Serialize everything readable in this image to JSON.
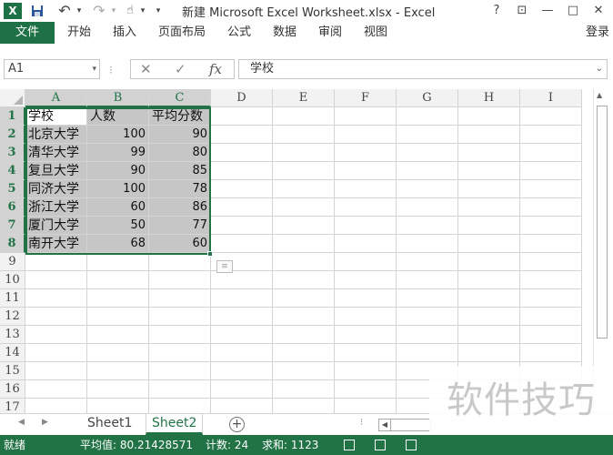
{
  "window": {
    "title": "新建 Microsoft Excel Worksheet.xlsx - Excel",
    "help": "?",
    "restore_ribbon": "⊡",
    "minimize": "—",
    "maximize": "□",
    "close": "✕"
  },
  "quick_access": {
    "logo": "X",
    "save_icon": "💾",
    "undo_icon": "↶",
    "redo_icon": "↷",
    "touch_icon": "☝",
    "customize_icon": "▾"
  },
  "ribbon": {
    "file_tab": "文件",
    "tabs": [
      "开始",
      "插入",
      "页面布局",
      "公式",
      "数据",
      "审阅",
      "视图"
    ],
    "login": "登录"
  },
  "formula_bar": {
    "name_box": "A1",
    "name_box_arrow": "▾",
    "separator": "⁝",
    "cancel_icon": "✕",
    "enter_icon": "✓",
    "fx_label": "fx",
    "formula": "学校",
    "expand_icon": "⌄"
  },
  "columns": [
    "A",
    "B",
    "C",
    "D",
    "E",
    "F",
    "G",
    "H",
    "I"
  ],
  "rows": [
    "1",
    "2",
    "3",
    "4",
    "5",
    "6",
    "7",
    "8",
    "9",
    "10",
    "11",
    "12",
    "13",
    "14",
    "15",
    "16",
    "17"
  ],
  "table": {
    "headers": [
      "学校",
      "人数",
      "平均分数"
    ],
    "rows": [
      [
        "北京大学",
        "100",
        "90"
      ],
      [
        "清华大学",
        "99",
        "80"
      ],
      [
        "复旦大学",
        "90",
        "85"
      ],
      [
        "同济大学",
        "100",
        "78"
      ],
      [
        "浙江大学",
        "60",
        "86"
      ],
      [
        "厦门大学",
        "50",
        "77"
      ],
      [
        "南开大学",
        "68",
        "60"
      ]
    ]
  },
  "quick_analysis_icon": "≡",
  "sheet_tabs": {
    "prev_icon": "◀",
    "next_icon": "▶",
    "tabs": [
      "Sheet1",
      "Sheet2"
    ],
    "active": "Sheet2",
    "add_icon": "+",
    "dots": "⁝",
    "scroll_left_icon": "◀"
  },
  "vscroll_up_icon": "▲",
  "status_bar": {
    "ready": "就绪",
    "average": "平均值: 80.21428571",
    "count": "计数: 24",
    "sum": "求和: 1123"
  },
  "watermark": "软件技巧",
  "colors": {
    "accent": "#217346",
    "selection": "#c6c6c6",
    "header_bg": "#f2f2f2"
  }
}
